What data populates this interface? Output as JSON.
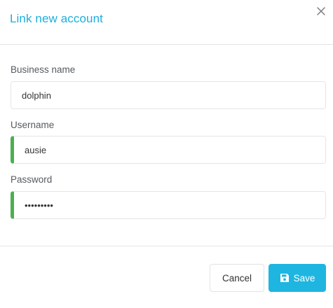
{
  "dialog": {
    "title": "Link new account",
    "close_icon": "close-icon"
  },
  "form": {
    "business_name": {
      "label": "Business name",
      "value": "dolphin"
    },
    "username": {
      "label": "Username",
      "value": "ausie",
      "status": "valid"
    },
    "password": {
      "label": "Password",
      "value": "•••••••••",
      "status": "valid"
    }
  },
  "footer": {
    "cancel_label": "Cancel",
    "save_label": "Save",
    "save_icon": "floppy-disk-icon"
  },
  "colors": {
    "accent": "#1eaede",
    "save_button": "#1eb6e0",
    "valid_indicator": "#4caf50"
  }
}
